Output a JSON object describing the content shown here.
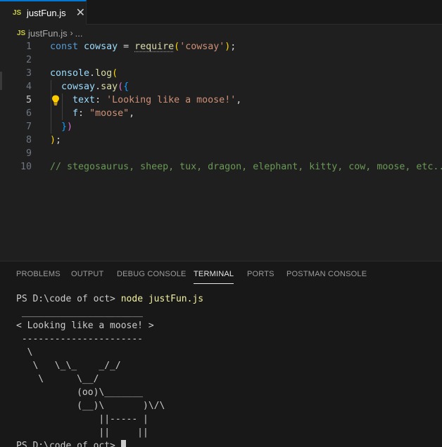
{
  "tab": {
    "icon": "JS",
    "label": "justFun.js",
    "close": "✕"
  },
  "breadcrumb": {
    "icon": "JS",
    "file": "justFun.js",
    "sep": "›",
    "more": "..."
  },
  "editor": {
    "lines": [
      {
        "n": "1",
        "tokens": [
          {
            "t": "const ",
            "c": "kw"
          },
          {
            "t": "cowsay",
            "c": "var"
          },
          {
            "t": " = ",
            "c": "pl"
          },
          {
            "t": "require",
            "c": "fn dotted"
          },
          {
            "t": "(",
            "c": "br1"
          },
          {
            "t": "'cowsay'",
            "c": "str"
          },
          {
            "t": ")",
            "c": "br1"
          },
          {
            "t": ";",
            "c": "pl"
          }
        ]
      },
      {
        "n": "2",
        "tokens": []
      },
      {
        "n": "3",
        "tokens": [
          {
            "t": "console",
            "c": "var"
          },
          {
            "t": ".",
            "c": "pl"
          },
          {
            "t": "log",
            "c": "fn"
          },
          {
            "t": "(",
            "c": "br1"
          }
        ]
      },
      {
        "n": "4",
        "tokens": [
          {
            "t": "  ",
            "c": "pl"
          },
          {
            "t": "cowsay",
            "c": "var"
          },
          {
            "t": ".",
            "c": "pl"
          },
          {
            "t": "say",
            "c": "fn"
          },
          {
            "t": "(",
            "c": "br2"
          },
          {
            "t": "{",
            "c": "br3"
          }
        ]
      },
      {
        "n": "5",
        "active": true,
        "tokens": [
          {
            "t": "    ",
            "c": "pl"
          },
          {
            "t": "text",
            "c": "var"
          },
          {
            "t": ": ",
            "c": "pl"
          },
          {
            "t": "'Looking like a moose!'",
            "c": "str"
          },
          {
            "t": ",",
            "c": "pl"
          }
        ]
      },
      {
        "n": "6",
        "tokens": [
          {
            "t": "    ",
            "c": "pl"
          },
          {
            "t": "f",
            "c": "var"
          },
          {
            "t": ": ",
            "c": "pl"
          },
          {
            "t": "\"moose\"",
            "c": "str"
          },
          {
            "t": ",",
            "c": "pl"
          }
        ]
      },
      {
        "n": "7",
        "tokens": [
          {
            "t": "  ",
            "c": "pl"
          },
          {
            "t": "}",
            "c": "br3"
          },
          {
            "t": ")",
            "c": "br2"
          }
        ]
      },
      {
        "n": "8",
        "tokens": [
          {
            "t": ")",
            "c": "br1"
          },
          {
            "t": ";",
            "c": "pl"
          }
        ]
      },
      {
        "n": "9",
        "tokens": []
      },
      {
        "n": "10",
        "tokens": [
          {
            "t": "// stegosaurus, sheep, tux, dragon, elephant, kitty, cow, moose, etc..",
            "c": "cm"
          }
        ]
      }
    ]
  },
  "panel": {
    "tabs": [
      {
        "label": "PROBLEMS",
        "active": false
      },
      {
        "label": "OUTPUT",
        "active": false
      },
      {
        "label": "DEBUG CONSOLE",
        "active": false
      },
      {
        "label": "TERMINAL",
        "active": true
      },
      {
        "label": "PORTS",
        "active": false
      },
      {
        "label": "POSTMAN CONSOLE",
        "active": false
      }
    ]
  },
  "terminal": {
    "prompt": "PS D:\\code of oct> ",
    "command": "node justFun.js",
    "output": [
      " ______________________",
      "< Looking like a moose! >",
      " ----------------------",
      "  \\",
      "   \\   \\_\\_    _/_/",
      "    \\      \\__/",
      "           (oo)\\_______",
      "           (__)\\       )\\/\\",
      "               ||----- |",
      "               ||     ||"
    ],
    "final_prompt": "PS D:\\code of oct> "
  }
}
